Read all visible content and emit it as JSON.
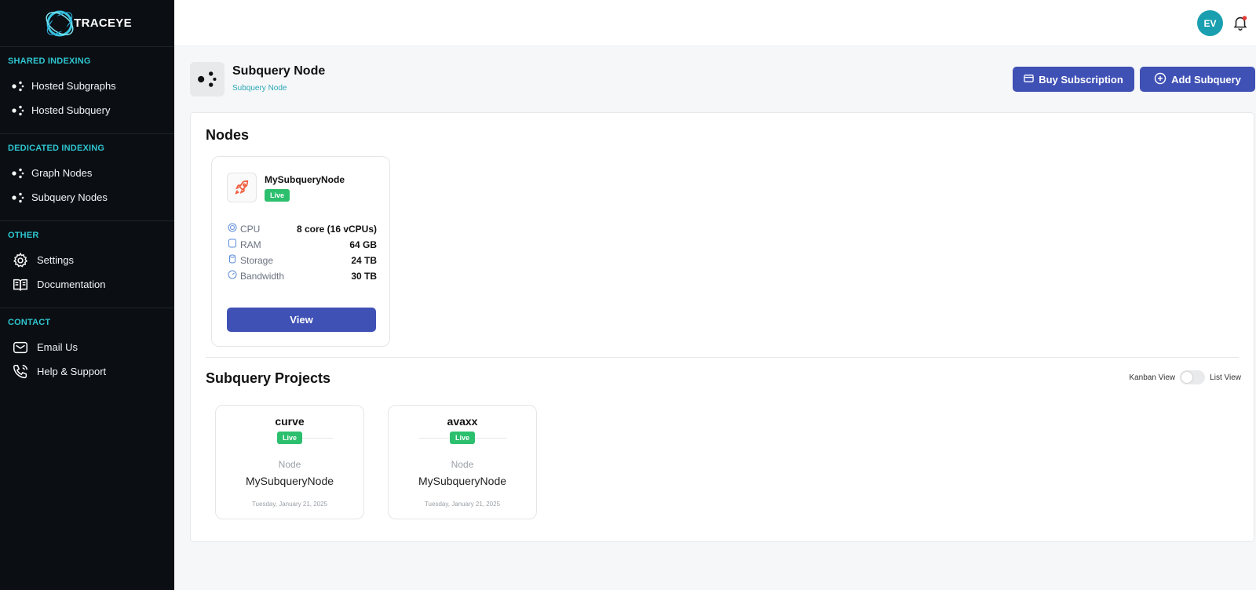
{
  "brand": {
    "name": "TRACEYE"
  },
  "sidebar": {
    "sections": [
      {
        "title": "SHARED INDEXING",
        "items": [
          {
            "label": "Hosted Subgraphs",
            "icon": "node-graph-icon"
          },
          {
            "label": "Hosted Subquery",
            "icon": "node-graph-icon"
          }
        ]
      },
      {
        "title": "DEDICATED INDEXING",
        "items": [
          {
            "label": "Graph Nodes",
            "icon": "node-graph-icon"
          },
          {
            "label": "Subquery Nodes",
            "icon": "node-graph-icon"
          }
        ]
      },
      {
        "title": "OTHER",
        "items": [
          {
            "label": "Settings",
            "icon": "gear-icon"
          },
          {
            "label": "Documentation",
            "icon": "book-icon"
          }
        ]
      },
      {
        "title": "CONTACT",
        "items": [
          {
            "label": "Email Us",
            "icon": "mail-icon"
          },
          {
            "label": "Help & Support",
            "icon": "phone-icon"
          }
        ]
      }
    ]
  },
  "topbar": {
    "avatar_initials": "EV"
  },
  "header": {
    "title": "Subquery Node",
    "breadcrumb": "Subquery Node",
    "buy_label": "Buy Subscription",
    "add_label": "Add Subquery"
  },
  "nodes": {
    "heading": "Nodes",
    "items": [
      {
        "name": "MySubqueryNode",
        "status": "Live",
        "specs": [
          {
            "label": "CPU",
            "value": "8 core (16 vCPUs)"
          },
          {
            "label": "RAM",
            "value": "64 GB"
          },
          {
            "label": "Storage",
            "value": "24 TB"
          },
          {
            "label": "Bandwidth",
            "value": "30 TB"
          }
        ],
        "view_label": "View"
      }
    ]
  },
  "projects": {
    "heading": "Subquery Projects",
    "toggle_left": "Kanban View",
    "toggle_right": "List View",
    "items": [
      {
        "name": "curve",
        "status": "Live",
        "node_label": "Node",
        "node_name": "MySubqueryNode",
        "date": "Tuesday, January 21, 2025"
      },
      {
        "name": "avaxx",
        "status": "Live",
        "node_label": "Node",
        "node_name": "MySubqueryNode",
        "date": "Tuesday, January 21, 2025"
      }
    ]
  },
  "colors": {
    "accent": "#3f51b5",
    "teal": "#2ec5cf",
    "live": "#2cbf6e",
    "sidebar_bg": "#0b0f14"
  }
}
